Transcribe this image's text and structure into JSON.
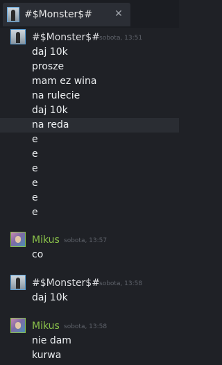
{
  "tab": {
    "title": "#$Monster$#",
    "close_glyph": "✕"
  },
  "icons": {
    "tab_avatar": "monster-avatar-icon",
    "close": "close-icon"
  },
  "colors": {
    "monster_name": "#dcdde0",
    "mikus_name": "#8bc34a",
    "timestamp": "#5f636b",
    "highlight": "#2a2d33"
  },
  "groups": [
    {
      "author": "#$Monster$#",
      "time": "sobota, 13:51",
      "messages": [
        "daj 10k",
        "prosze",
        "mam ez wina",
        "na rulecie",
        "daj 10k",
        "na reda",
        "e",
        "e",
        "e",
        "e",
        "e",
        "e"
      ]
    },
    {
      "author": "Mikus",
      "time": "sobota, 13:57",
      "messages": [
        "co"
      ]
    },
    {
      "author": "#$Monster$#",
      "time": "sobota, 13:58",
      "messages": [
        "daj 10k"
      ]
    },
    {
      "author": "Mikus",
      "time": "sobota, 13:58",
      "messages": [
        "nie dam",
        "kurwa"
      ]
    }
  ]
}
